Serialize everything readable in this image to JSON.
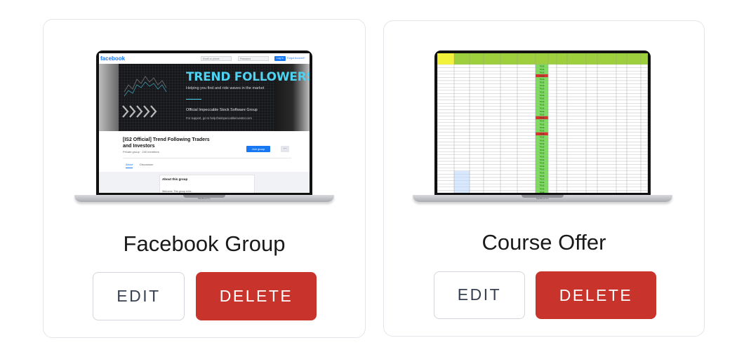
{
  "cards": [
    {
      "title": "Facebook Group",
      "edit_label": "EDIT",
      "delete_label": "DELETE",
      "screen": {
        "logo": "facebook",
        "email_placeholder": "Email or phone",
        "password_placeholder": "Password",
        "login_label": "Log In",
        "forgot_label": "Forgot Account?",
        "banner_title": "TREND FOLLOWERS",
        "banner_subtitle": "Helping you find and ride waves in the market",
        "banner_official": "Official Impeccable Stock Software Group",
        "banner_support": "For support, go to help.theimpeccableinvestor.com",
        "group_name": "[IS2 Official] Trend Following Traders and Investors",
        "group_meta": "Private group · 240 members",
        "join_label": "Join group",
        "more_label": "...",
        "tab_about": "About",
        "tab_discussion": "Discussion",
        "about_title": "About this group",
        "about_text": "Welcome. This group is for... ",
        "device_label": "MacBook Pro"
      }
    },
    {
      "title": "Course Offer",
      "edit_label": "EDIT",
      "delete_label": "DELETE",
      "screen": {
        "device_label": "MacBook Pro",
        "status_text": "TRUE",
        "colors": {
          "header": "#9ecf3c",
          "yellow": "#f2f23a",
          "green": "#7ee05a",
          "red": "#d9332b"
        }
      }
    }
  ],
  "colors": {
    "delete": "#c8342b",
    "facebook_blue": "#1877f2",
    "accent_cyan": "#4fd1f0"
  }
}
